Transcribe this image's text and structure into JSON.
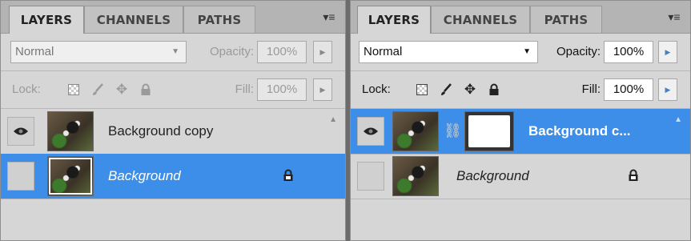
{
  "panel_left": {
    "tabs": [
      {
        "label": "LAYERS"
      },
      {
        "label": "CHANNELS"
      },
      {
        "label": "PATHS"
      }
    ],
    "menu_icon": "panel-menu-icon",
    "blend_mode": "Normal",
    "opacity_label": "Opacity:",
    "opacity_value": "100%",
    "lock_label": "Lock:",
    "fill_label": "Fill:",
    "fill_value": "100%",
    "layers": [
      {
        "name": "Background copy",
        "visible": true,
        "selected": false,
        "locked": false
      },
      {
        "name": "Background",
        "visible": false,
        "selected": true,
        "locked": true
      }
    ]
  },
  "panel_right": {
    "tabs": [
      {
        "label": "LAYERS"
      },
      {
        "label": "CHANNELS"
      },
      {
        "label": "PATHS"
      }
    ],
    "menu_icon": "panel-menu-icon",
    "blend_mode": "Normal",
    "opacity_label": "Opacity:",
    "opacity_value": "100%",
    "lock_label": "Lock:",
    "fill_label": "Fill:",
    "fill_value": "100%",
    "layers": [
      {
        "name": "Background c...",
        "visible": true,
        "selected": true,
        "locked": false,
        "has_mask": true
      },
      {
        "name": "Background",
        "visible": false,
        "selected": false,
        "locked": true
      }
    ]
  },
  "colors": {
    "selection": "#3d8ee8",
    "panel_bg": "#d6d6d6"
  }
}
